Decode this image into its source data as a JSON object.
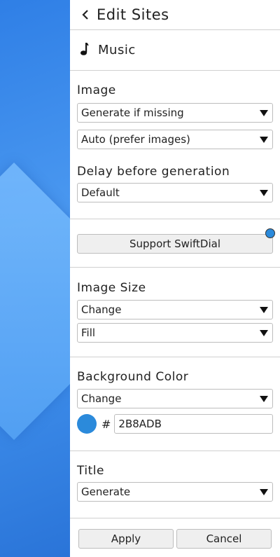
{
  "header": {
    "title": "Edit Sites",
    "back_icon": "chevron-left-icon"
  },
  "site": {
    "name": "Music",
    "icon": "music-note-icon"
  },
  "image_section": {
    "label": "Image",
    "mode_value": "Generate if missing",
    "type_value": "Auto (prefer images)",
    "delay_label": "Delay before generation",
    "delay_value": "Default"
  },
  "support": {
    "label": "Support SwiftDial",
    "dot_color": "#2b8adb"
  },
  "image_size": {
    "label": "Image Size",
    "change_value": "Change",
    "fit_value": "Fill"
  },
  "background_color": {
    "label": "Background Color",
    "change_value": "Change",
    "hash": "#",
    "hex_value": "2B8ADB",
    "swatch_color": "#2b8adb"
  },
  "title_section": {
    "label": "Title",
    "value": "Generate"
  },
  "footer": {
    "apply_label": "Apply",
    "cancel_label": "Cancel"
  }
}
